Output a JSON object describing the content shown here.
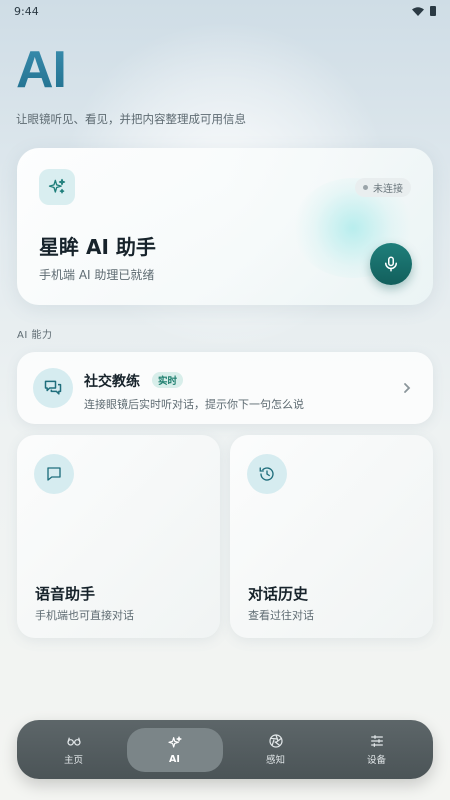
{
  "status_bar": {
    "time": "9:44"
  },
  "header": {
    "title": "AI",
    "subtitle": "让眼镜听见、看见，并把内容整理成可用信息"
  },
  "assistant_card": {
    "title": "星眸 AI 助手",
    "subtitle": "手机端 AI 助理已就绪",
    "status": "未连接"
  },
  "section_label": "AI 能力",
  "social_coach": {
    "title": "社交教练",
    "badge": "实时",
    "subtitle": "连接眼镜后实时听对话，提示你下一句怎么说"
  },
  "tiles": [
    {
      "title": "语音助手",
      "subtitle": "手机端也可直接对话",
      "icon": "chat-bubble-icon"
    },
    {
      "title": "对话历史",
      "subtitle": "查看过往对话",
      "icon": "history-icon"
    }
  ],
  "bottom_nav": [
    {
      "label": "主页",
      "icon": "glasses-icon",
      "active": false
    },
    {
      "label": "AI",
      "icon": "sparkle-icon",
      "active": true
    },
    {
      "label": "感知",
      "icon": "aperture-icon",
      "active": false
    },
    {
      "label": "设备",
      "icon": "sliders-icon",
      "active": false
    }
  ],
  "colors": {
    "accent": "#1f7f7b",
    "title_gradient_top": "#3c8fb0",
    "nav_bg": "#555e61"
  }
}
